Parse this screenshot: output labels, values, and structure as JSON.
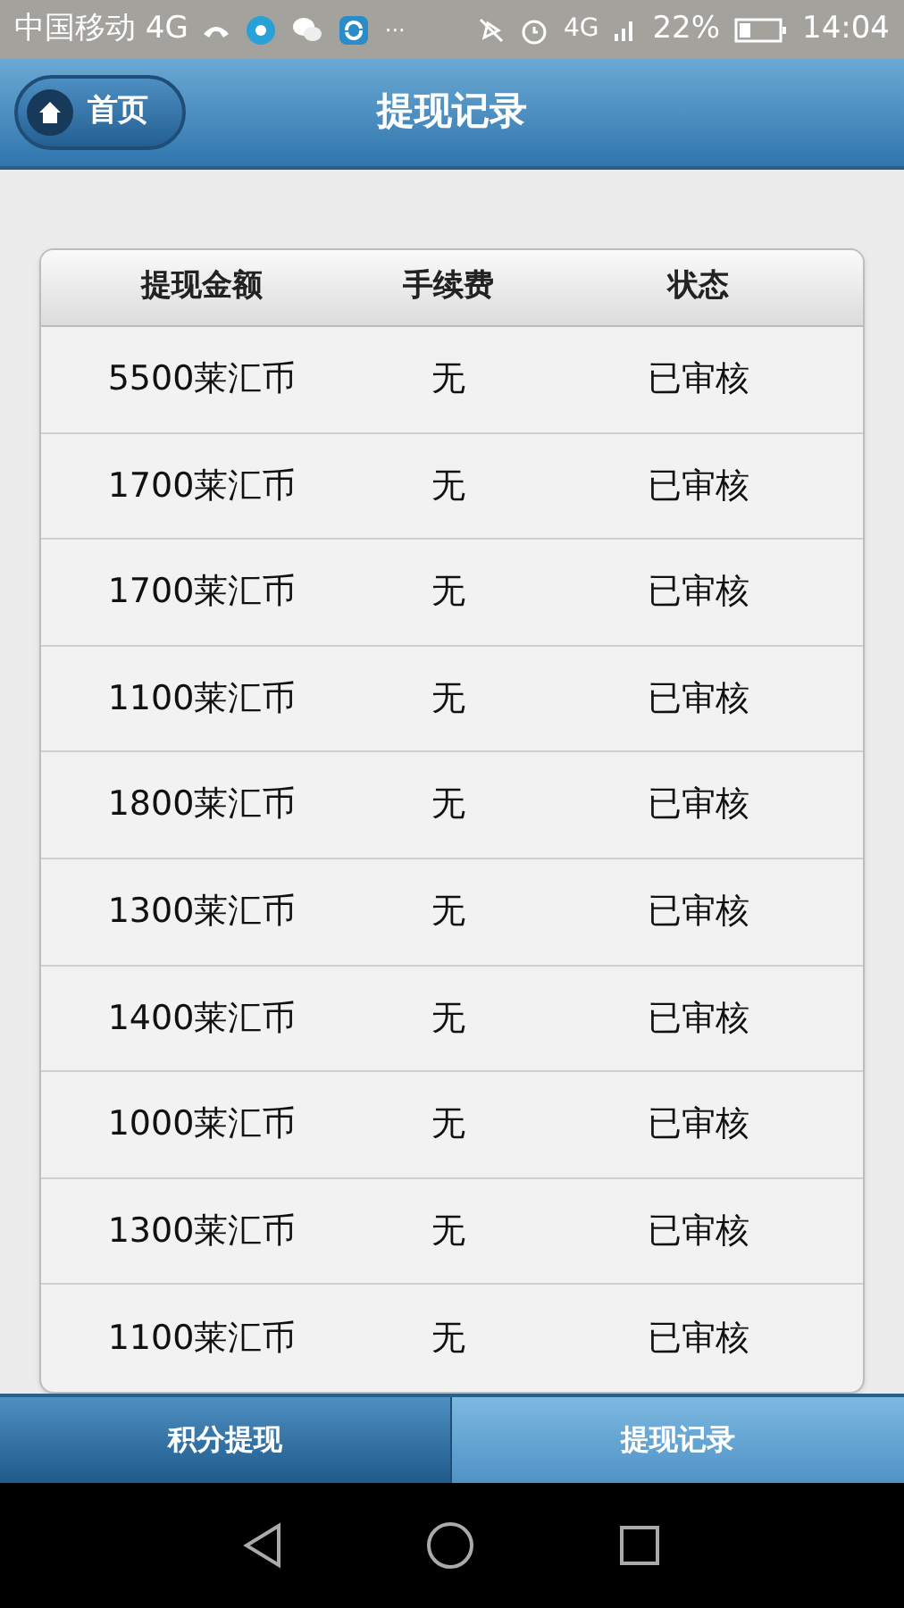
{
  "status_bar": {
    "carrier": "中国移动 4G",
    "more": "···",
    "network": "4G",
    "battery": "22%",
    "time": "14:04"
  },
  "header": {
    "home_button": "首页",
    "title": "提现记录"
  },
  "table": {
    "columns": [
      "提现金额",
      "手续费",
      "状态"
    ],
    "rows": [
      [
        "5500莱汇币",
        "无",
        "已审核"
      ],
      [
        "1700莱汇币",
        "无",
        "已审核"
      ],
      [
        "1700莱汇币",
        "无",
        "已审核"
      ],
      [
        "1100莱汇币",
        "无",
        "已审核"
      ],
      [
        "1800莱汇币",
        "无",
        "已审核"
      ],
      [
        "1300莱汇币",
        "无",
        "已审核"
      ],
      [
        "1400莱汇币",
        "无",
        "已审核"
      ],
      [
        "1000莱汇币",
        "无",
        "已审核"
      ],
      [
        "1300莱汇币",
        "无",
        "已审核"
      ],
      [
        "1100莱汇币",
        "无",
        "已审核"
      ]
    ]
  },
  "tabs": [
    {
      "label": "积分提现",
      "selected": false
    },
    {
      "label": "提现记录",
      "selected": true
    }
  ]
}
